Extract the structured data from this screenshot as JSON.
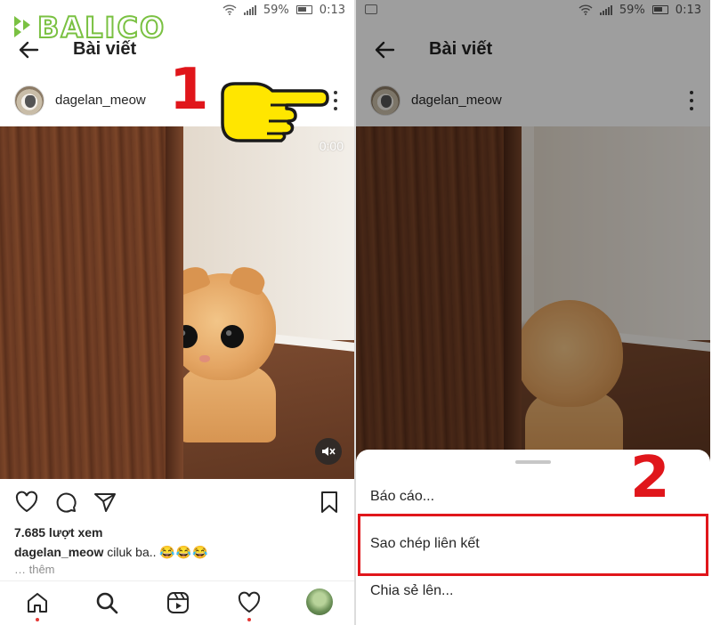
{
  "brand": {
    "logo_text": "BALICO",
    "logo_color": "#7ac142"
  },
  "status_bar": {
    "battery": "59%",
    "time": "0:13"
  },
  "post": {
    "header_title": "Bài viết",
    "username": "dagelan_meow",
    "video_time": "0:00",
    "views": "7.685 lượt xem",
    "caption_user": "dagelan_meow",
    "caption_text": " ciluk ba..",
    "caption_emoji": "😂😂😂",
    "more_label": "… thêm"
  },
  "menu": {
    "items": [
      {
        "label": "Báo cáo..."
      },
      {
        "label": "Sao chép liên kết"
      },
      {
        "label": "Chia sẻ lên..."
      }
    ],
    "highlighted_index": 1
  },
  "annotations": {
    "step1": "1",
    "step2": "2",
    "accent_color": "#e0161b"
  },
  "icons": {
    "nav": [
      "home-icon",
      "search-icon",
      "reels-icon",
      "heart-icon",
      "profile-avatar"
    ],
    "actions": [
      "like-icon",
      "comment-icon",
      "share-icon",
      "bookmark-icon"
    ]
  }
}
